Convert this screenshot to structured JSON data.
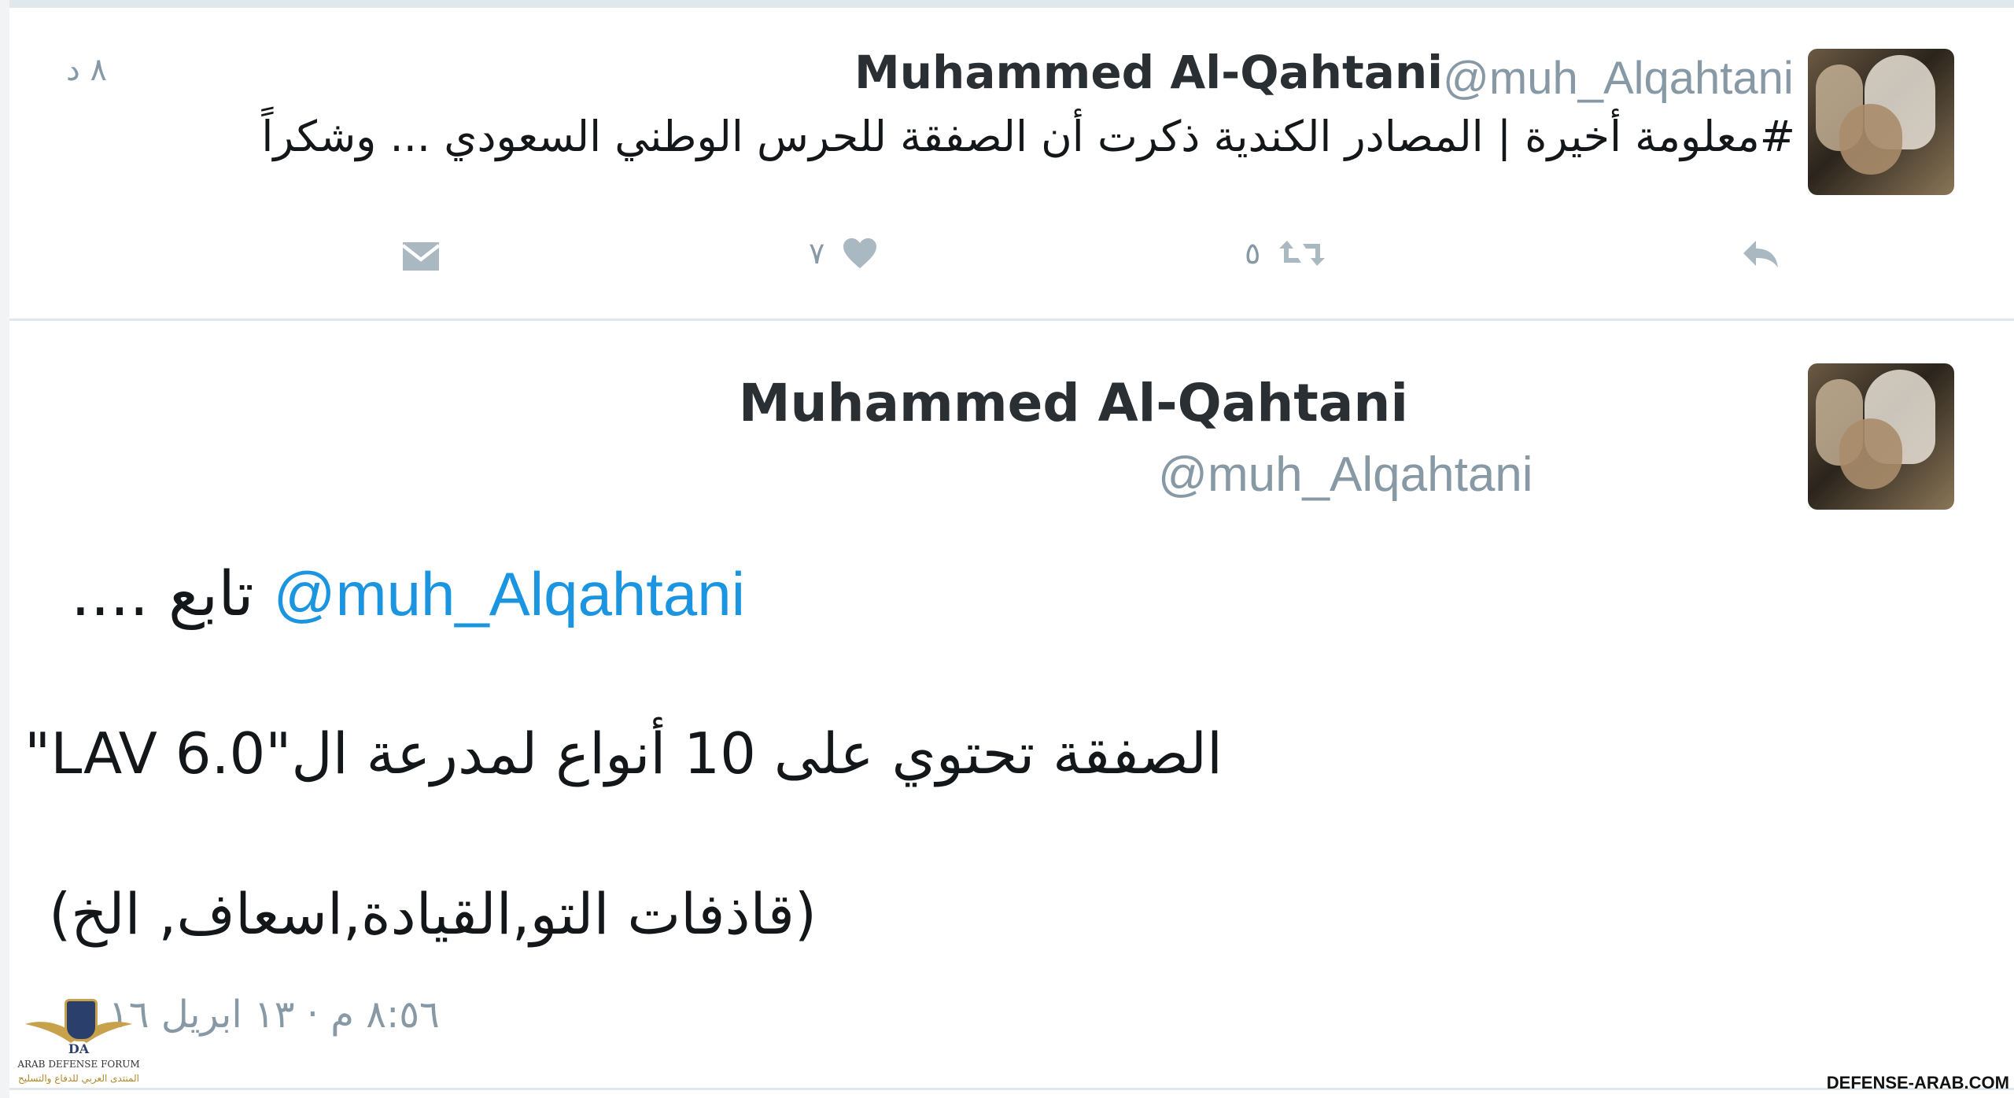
{
  "tweet1": {
    "name": "Muhammed Al-Qahtani",
    "handle": "@muh_Alqahtani",
    "time": "٨ د",
    "text": "#معلومة أخيرة | المصادر الكندية ذكرت أن الصفقة للحرس الوطني السعودي ... وشكراً",
    "retweet_count": "٥",
    "like_count": "٧"
  },
  "tweet2": {
    "name": "Muhammed Al-Qahtani",
    "handle": "@muh_Alqahtani",
    "mention": "@muh_Alqahtani",
    "line1_suffix": "تابع ....",
    "line2": "الصفقة تحتوي على 10 أنواع لمدرعة ال\"LAV 6.0\"",
    "line3": "(قاذفات التو,القيادة,اسعاف, الخ)",
    "timestamp": "٨:٥٦ م · ١٣ ابريل ١٦"
  },
  "watermark": {
    "logo_text_en": "ARAB DEFENSE FORUM",
    "logo_text_ar": "المنتدى العربي للدفاع والتسليح",
    "logo_badge": "DA",
    "site": "DEFENSE-ARAB.COM"
  },
  "colors": {
    "link": "#1b95e0",
    "muted": "#8899a6",
    "icon": "#aab8c2",
    "divider": "#e1e8ed"
  }
}
